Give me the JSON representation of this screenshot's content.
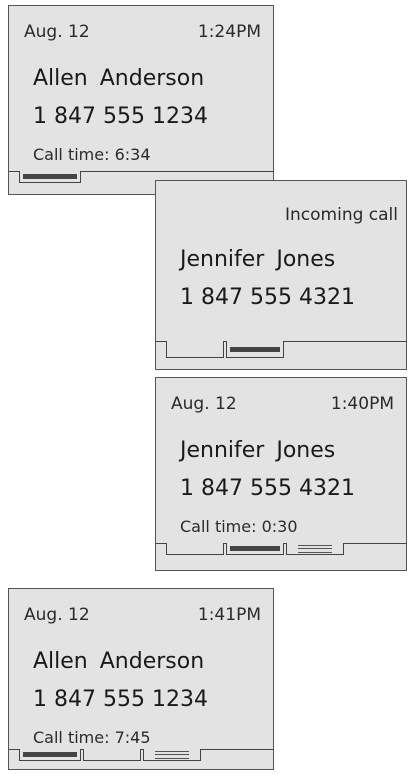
{
  "screens": [
    {
      "date": "Aug. 12",
      "time": "1:24PM",
      "name": "Allen  Anderson",
      "number": "1 847 555 1234",
      "call_time": "Call time: 6:34"
    },
    {
      "status": "Incoming call",
      "name": "Jennifer  Jones",
      "number": "1 847 555 4321"
    },
    {
      "date": "Aug. 12",
      "time": "1:40PM",
      "name": "Jennifer  Jones",
      "number": "1 847 555 4321",
      "call_time": "Call time: 0:30"
    },
    {
      "date": "Aug. 12",
      "time": "1:41PM",
      "name": "Allen  Anderson",
      "number": "1 847 555 1234",
      "call_time": "Call time: 7:45"
    }
  ],
  "tab_icons": [
    "active-call-bar-icon",
    "empty-tab",
    "menu-lines-icon"
  ],
  "colors": {
    "screen_bg": "#e3e3e3",
    "border": "#555555",
    "text": "#1a1a1a",
    "active_tab_bar": "#444444"
  }
}
